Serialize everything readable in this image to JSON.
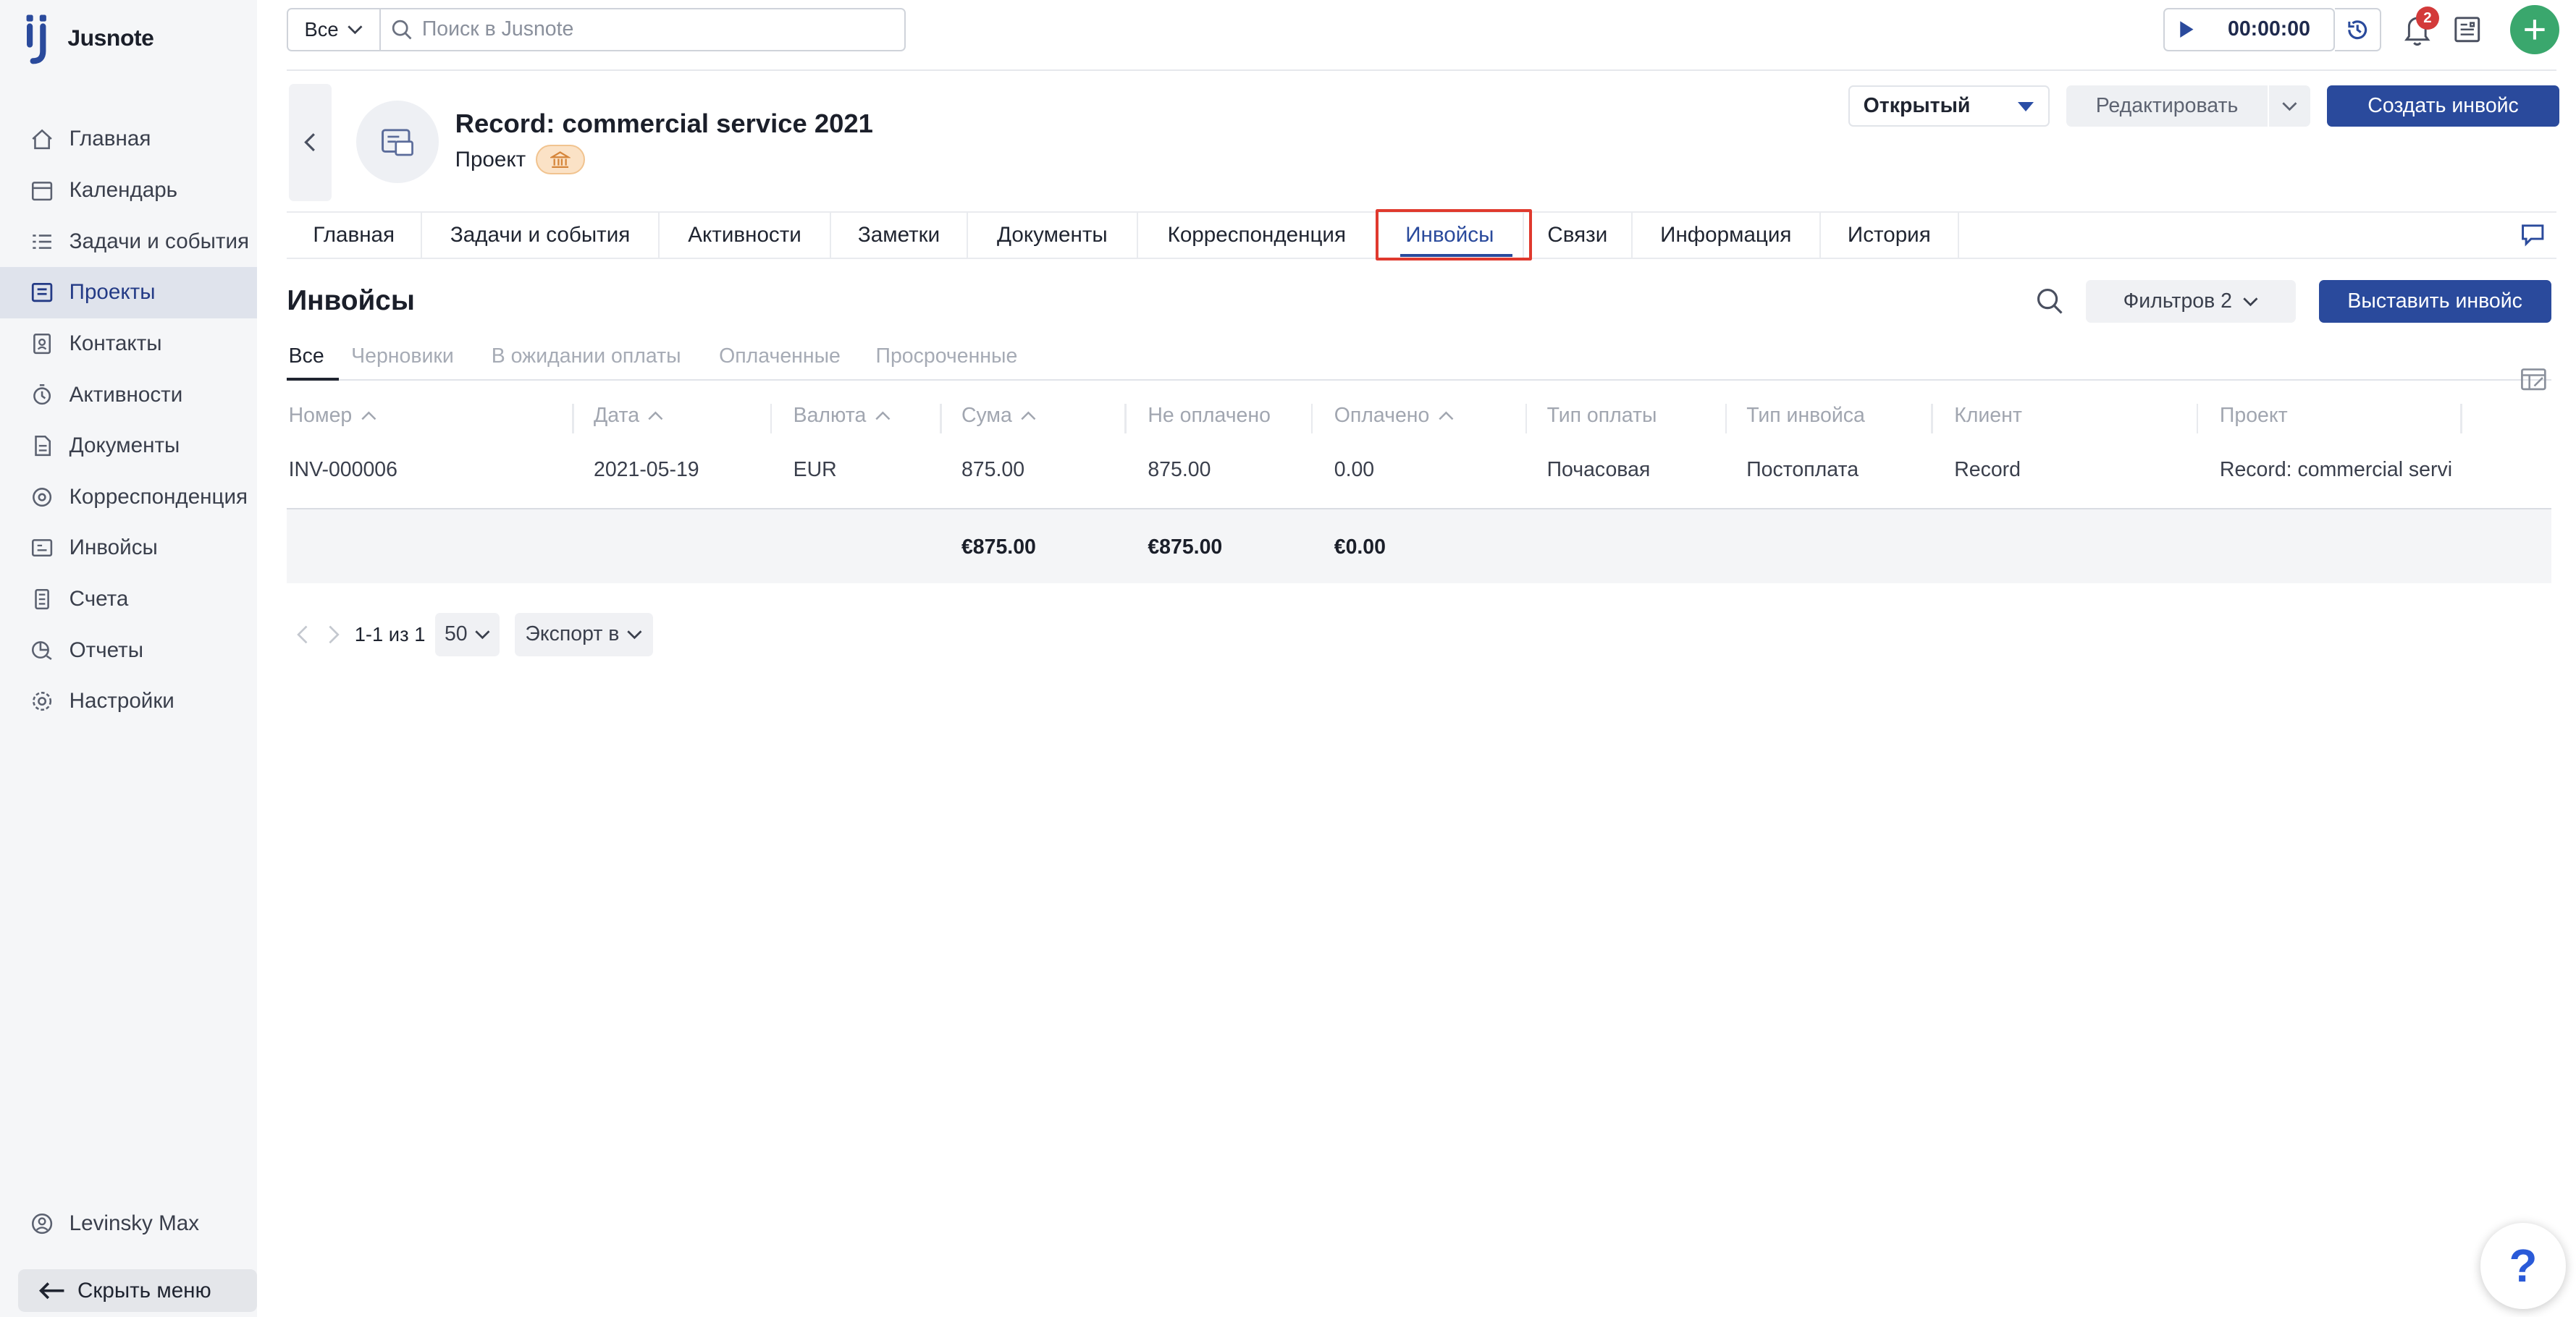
{
  "app": {
    "name": "Jusnote"
  },
  "sidebar": {
    "items": [
      {
        "label": "Главная",
        "icon": "home-icon"
      },
      {
        "label": "Календарь",
        "icon": "calendar-icon"
      },
      {
        "label": "Задачи и события",
        "icon": "tasks-icon"
      },
      {
        "label": "Проекты",
        "icon": "projects-icon"
      },
      {
        "label": "Контакты",
        "icon": "contacts-icon"
      },
      {
        "label": "Активности",
        "icon": "activity-icon"
      },
      {
        "label": "Документы",
        "icon": "documents-icon"
      },
      {
        "label": "Корреспонденция",
        "icon": "correspondence-icon"
      },
      {
        "label": "Инвойсы",
        "icon": "invoices-icon"
      },
      {
        "label": "Счета",
        "icon": "accounts-icon"
      },
      {
        "label": "Отчеты",
        "icon": "reports-icon"
      },
      {
        "label": "Настройки",
        "icon": "settings-icon"
      }
    ],
    "active_index": 3,
    "user": "Levinsky Max",
    "hide_menu": "Скрыть меню"
  },
  "topbar": {
    "scope": "Все",
    "search_placeholder": "Поиск в Jusnote",
    "timer": "00:00:00",
    "notifications_count": "2"
  },
  "project": {
    "title": "Record: commercial service 2021",
    "type": "Проект",
    "status": "Открытый",
    "edit_label": "Редактировать",
    "create_invoice_label": "Создать инвойс"
  },
  "tabs": [
    {
      "label": "Главная"
    },
    {
      "label": "Задачи и события"
    },
    {
      "label": "Активности"
    },
    {
      "label": "Заметки"
    },
    {
      "label": "Документы"
    },
    {
      "label": "Корреспонденция"
    },
    {
      "label": "Инвойсы"
    },
    {
      "label": "Связи"
    },
    {
      "label": "Информация"
    },
    {
      "label": "История"
    }
  ],
  "active_tab_index": 6,
  "invoices": {
    "title": "Инвойсы",
    "filters_label": "Фильтров 2",
    "issue_label": "Выставить инвойс",
    "subtabs": [
      "Все",
      "Черновики",
      "В ожидании оплаты",
      "Оплаченные",
      "Просроченные"
    ],
    "active_subtab_index": 0,
    "columns": [
      "Номер",
      "Дата",
      "Валюта",
      "Сума",
      "Не оплачено",
      "Оплачено",
      "Тип оплаты",
      "Тип инвойса",
      "Клиент",
      "Проект"
    ],
    "rows": [
      [
        "INV-000006",
        "2021-05-19",
        "EUR",
        "875.00",
        "875.00",
        "0.00",
        "Почасовая",
        "Постоплата",
        "Record",
        "Record: commercial servi"
      ]
    ],
    "totals": {
      "sum": "€875.00",
      "unpaid": "€875.00",
      "paid": "€0.00"
    }
  },
  "pagination": {
    "range": "1-1 из 1",
    "page_size": "50",
    "export_label": "Экспорт в"
  },
  "help_label": "?"
}
